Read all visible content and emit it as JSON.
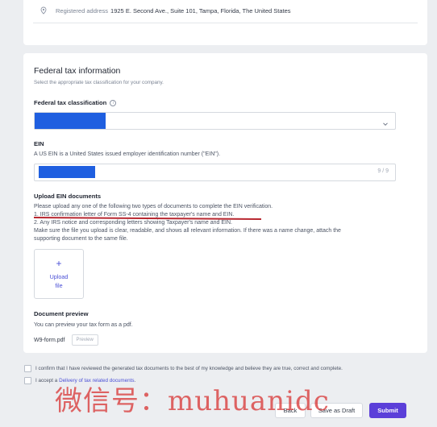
{
  "address": {
    "label": "Registered address",
    "value": "1925 E. Second Ave., Suite 101, Tampa, Florida, The United States"
  },
  "federal_tax": {
    "title": "Federal tax information",
    "subtitle": "Select the appropriate tax classification for your company.",
    "classification_label": "Federal tax classification",
    "info_glyph": "i"
  },
  "ein": {
    "label": "EIN",
    "help": "A US EIN is a United States issued employer identification number (\"EIN\").",
    "counter": "9 / 9"
  },
  "upload": {
    "title": "Upload EIN documents",
    "lines": [
      "Please upload any one of the following two types of documents to complete the EIN verification.",
      "1. IRS confirmation letter of Form SS-4 containing the taxpayer's name and EIN.",
      "2. Any IRS notice and corresponding letters showing Taxpayer's name and EIN.",
      "Make sure the file you upload is clear, readable, and shows all relevant information. If there was a name change, attach the",
      "supporting document to the same file."
    ],
    "tile_plus": "+",
    "tile_line1": "Upload",
    "tile_line2": "file"
  },
  "preview": {
    "title": "Document preview",
    "help": "You can preview your tax form as a pdf.",
    "filename": "W9-form.pdf",
    "button": "Preview"
  },
  "consent": {
    "confirm": "I confirm that I have reviewed the generated tax documents to the best of my knowledge and believe they are true, correct and complete.",
    "accept_prefix": "I accept a",
    "accept_link": "Delivery of tax related documents",
    "accept_suffix": "."
  },
  "footer": {
    "back": "Back",
    "draft": "Save as Draft",
    "submit": "Submit"
  },
  "watermark": "微信号：muhuanidc",
  "colors": {
    "redacted_fill": "#1f5fe0",
    "accent": "#5b3fd9",
    "link": "#4a4fd6",
    "annotation_red": "#b8262f"
  },
  "icons": {
    "address": "location-pin-icon",
    "info": "info-icon",
    "select": "chevron-down-icon",
    "upload": "plus-icon"
  }
}
